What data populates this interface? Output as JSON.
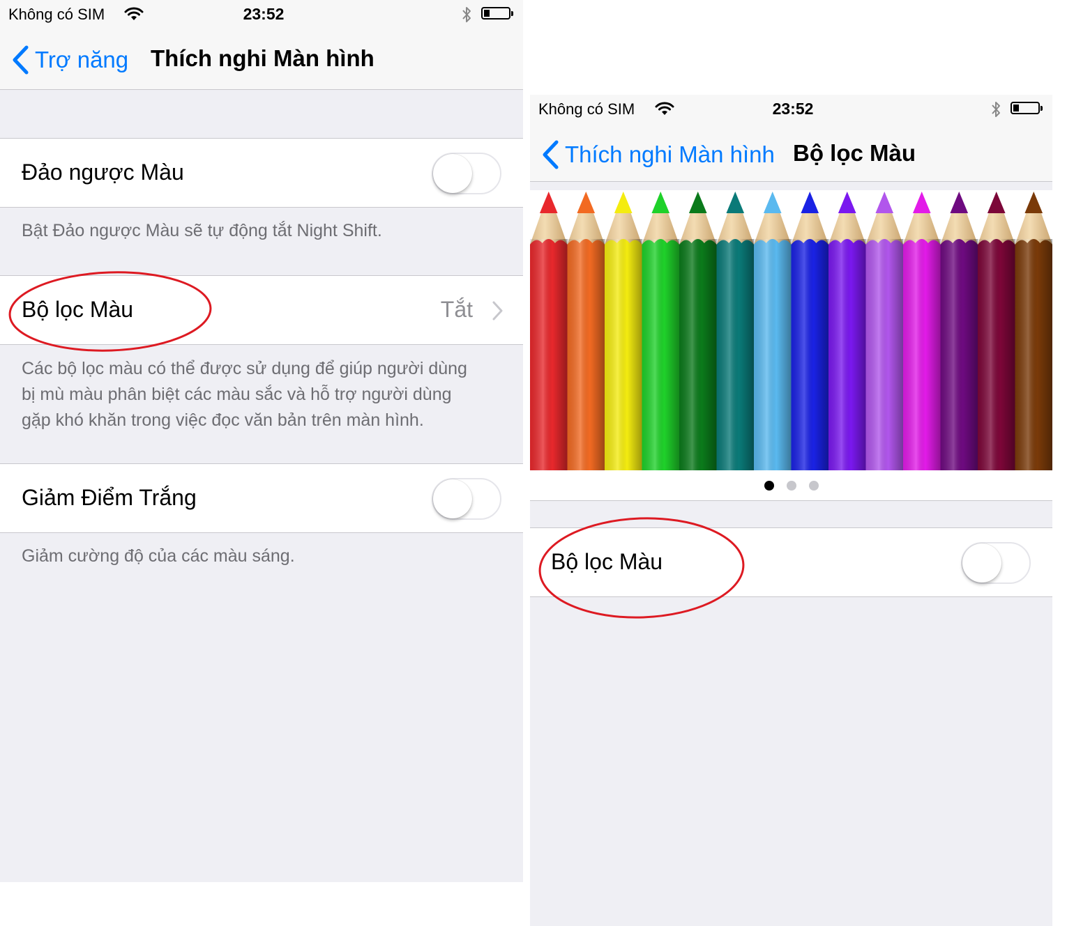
{
  "left_screen": {
    "status": {
      "carrier": "Không có SIM",
      "time": "23:52"
    },
    "nav": {
      "back_label": "Trợ năng",
      "title": "Thích nghi Màn hình"
    },
    "invert": {
      "label": "Đảo ngược Màu",
      "toggle_on": false,
      "footer": "Bật Đảo ngược Màu sẽ tự động tắt Night Shift."
    },
    "color_filters": {
      "label": "Bộ lọc Màu",
      "value": "Tắt",
      "footer_lines": [
        "Các bộ lọc màu có thể được sử dụng để giúp người dùng",
        "bị mù màu phân biệt các màu sắc và hỗ trợ người dùng",
        "gặp khó khăn trong việc đọc văn bản trên màn hình."
      ]
    },
    "reduce_white": {
      "label": "Giảm Điểm Trắng",
      "toggle_on": false,
      "footer": "Giảm cường độ của các màu sáng."
    }
  },
  "right_screen": {
    "status": {
      "carrier": "Không có SIM",
      "time": "23:52"
    },
    "nav": {
      "back_label": "Thích nghi Màn hình",
      "title": "Bộ lọc Màu"
    },
    "pencil_colors": [
      "#e8282c",
      "#f26a22",
      "#f4ec10",
      "#1fd12a",
      "#0b7a1b",
      "#0a7a78",
      "#5ab9ef",
      "#1a22e4",
      "#7a18ef",
      "#b156ec",
      "#e21be8",
      "#6e0a80",
      "#7c0638",
      "#7a3a09"
    ],
    "page_dots": {
      "count": 3,
      "active": 0
    },
    "color_filters": {
      "label": "Bộ lọc Màu",
      "toggle_on": false
    }
  },
  "colors": {
    "accent": "#007aff",
    "highlight": "#dd1a22",
    "group_background": "#efeff4"
  }
}
